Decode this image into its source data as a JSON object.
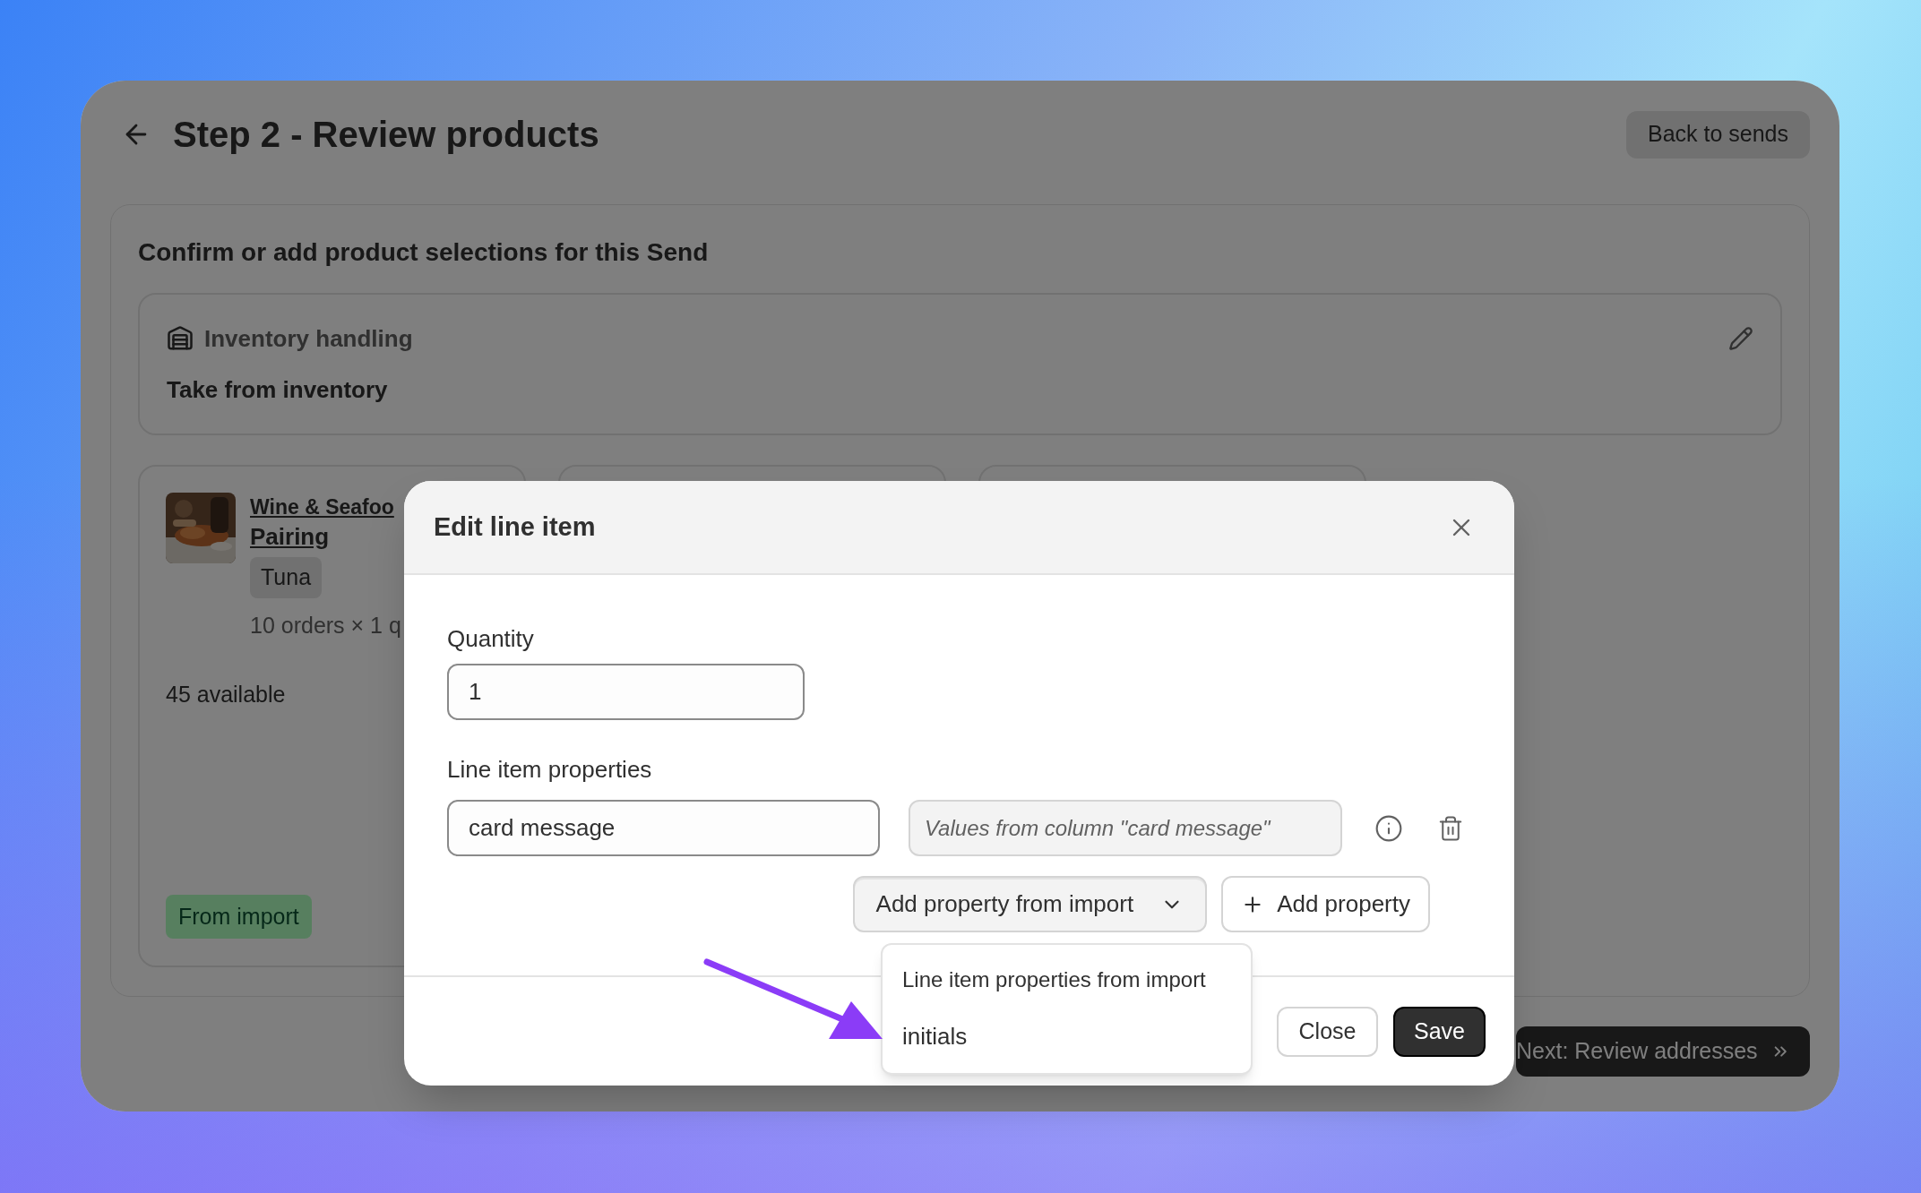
{
  "header": {
    "title": "Step 2 - Review products",
    "back_button": "Back to sends"
  },
  "section": {
    "title": "Confirm or add product selections for this Send",
    "inventory": {
      "label": "Inventory handling",
      "value": "Take from inventory"
    },
    "products": [
      {
        "name_line1": "Wine & Seafoo",
        "name_line2": "Pairing",
        "variant": "Tuna",
        "orders": "10 orders × 1 q",
        "available": "45 available",
        "badge": "From import"
      }
    ]
  },
  "next_button": "Next: Review addresses",
  "modal": {
    "title": "Edit line item",
    "quantity_label": "Quantity",
    "quantity_value": "1",
    "properties_label": "Line item properties",
    "properties": [
      {
        "name": "card message",
        "placeholder": "Values from column \"card message\""
      }
    ],
    "import_button": "Add property from import",
    "add_button": "Add property",
    "menu": [
      {
        "label": "Line item properties from import",
        "kind": "header"
      },
      {
        "label": "initials",
        "kind": "option"
      }
    ],
    "close": "Close",
    "save": "Save"
  }
}
